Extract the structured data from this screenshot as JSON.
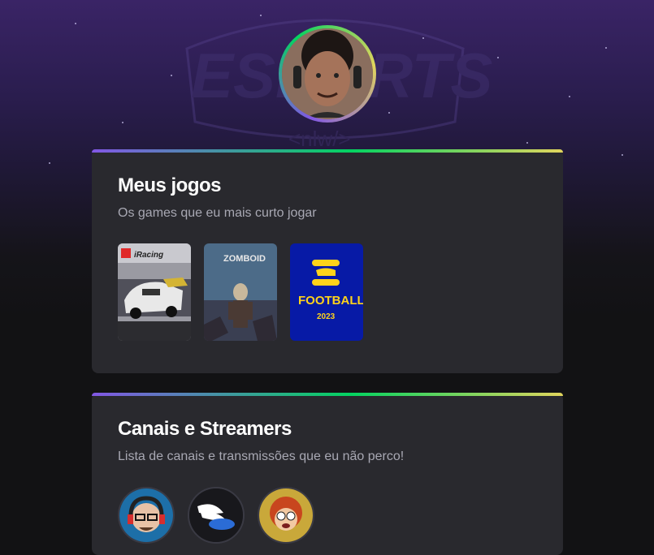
{
  "games_section": {
    "title": "Meus jogos",
    "subtitle": "Os games que eu mais curto jogar",
    "games": [
      {
        "name": "iRacing",
        "label": "iRacing",
        "icon": "iracing-cover"
      },
      {
        "name": "Project Zomboid",
        "label": "ZOMBOID",
        "icon": "zomboid-cover"
      },
      {
        "name": "eFootball 2023",
        "label": "FOOTBALL",
        "year": "2023",
        "icon": "efootball-cover"
      }
    ]
  },
  "streamers_section": {
    "title": "Canais e Streamers",
    "subtitle": "Lista de canais e transmissões que eu não perco!",
    "streamers": [
      {
        "icon": "streamer-avatar-headset"
      },
      {
        "icon": "streamer-avatar-wing"
      },
      {
        "icon": "streamer-avatar-cartoon"
      }
    ]
  },
  "colors": {
    "accent_purple": "#8257e5",
    "accent_green": "#04d361",
    "accent_yellow": "#e1d55d",
    "card_bg": "#29292e",
    "page_bg": "#121214"
  }
}
